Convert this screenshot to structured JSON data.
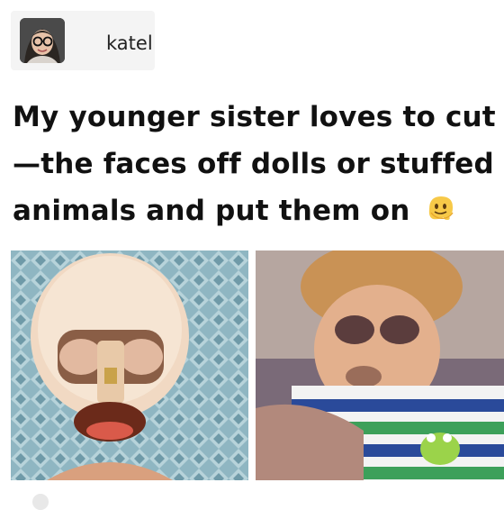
{
  "post": {
    "author": {
      "username": "katel",
      "avatar_icon": "profile-photo"
    },
    "caption": {
      "line1": "My younger sister loves to cut",
      "line2": "—the faces off dolls or stuffed",
      "line3": "animals and put them on",
      "emoji": "melting-face-emoji"
    },
    "images": [
      {
        "name": "doll-face-removed-photo"
      },
      {
        "name": "stuffed-animal-with-doll-face-photo"
      }
    ]
  },
  "colors": {
    "text": "#111111",
    "background": "#ffffff"
  }
}
